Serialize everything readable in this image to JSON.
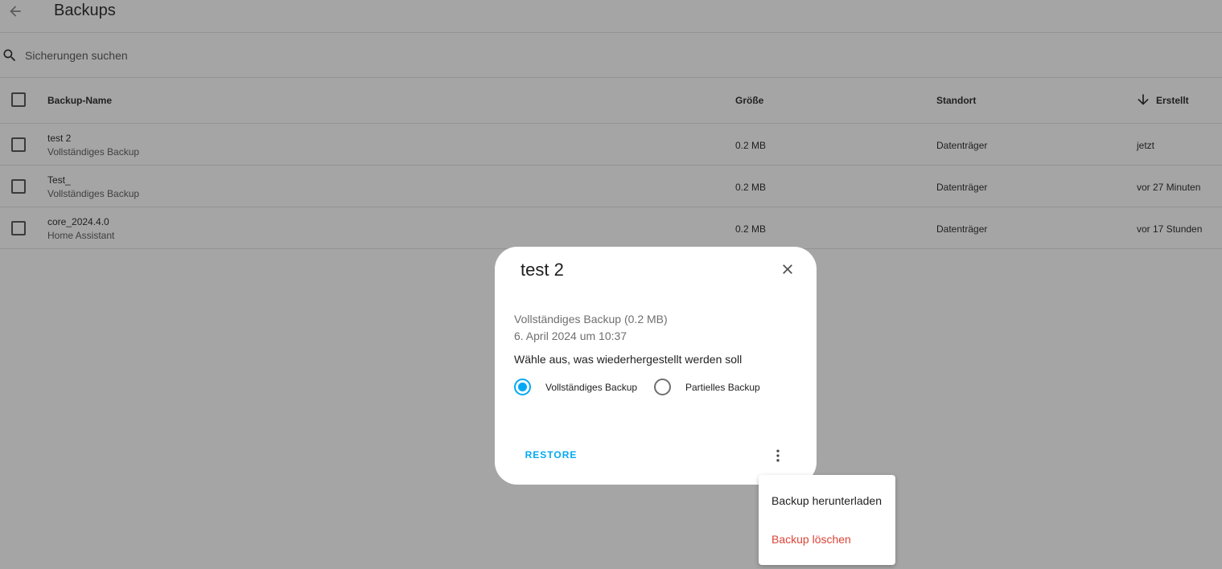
{
  "header": {
    "back_icon": "arrow-left-icon",
    "title": "Backups"
  },
  "search": {
    "icon": "search-icon",
    "placeholder": "Sicherungen suchen",
    "value": ""
  },
  "table": {
    "columns": {
      "name": "Backup-Name",
      "size": "Größe",
      "location": "Standort",
      "created": "Erstellt",
      "sort_icon": "arrow-down-icon"
    },
    "rows": [
      {
        "name": "test 2",
        "type": "Vollständiges Backup",
        "size": "0.2 MB",
        "location": "Datenträger",
        "created": "jetzt"
      },
      {
        "name": "Test_",
        "type": "Vollständiges Backup",
        "size": "0.2 MB",
        "location": "Datenträger",
        "created": "vor 27 Minuten"
      },
      {
        "name": "core_2024.4.0",
        "type": "Home Assistant",
        "size": "0.2 MB",
        "location": "Datenträger",
        "created": "vor 17 Stunden"
      }
    ]
  },
  "dialog": {
    "title": "test 2",
    "close_icon": "close-icon",
    "summary": "Vollständiges Backup (0.2 MB)",
    "date": "6. April 2024 um 10:37",
    "question": "Wähle aus, was wiederhergestellt werden soll",
    "options": [
      {
        "label": "Vollständiges Backup",
        "selected": true
      },
      {
        "label": "Partielles Backup",
        "selected": false
      }
    ],
    "restore_label": "RESTORE",
    "more_icon": "more-vertical-icon"
  },
  "menu": {
    "items": [
      {
        "label": "Backup herunterladen"
      },
      {
        "label": "Backup löschen"
      }
    ]
  },
  "colors": {
    "accent": "#03a9f4",
    "danger": "#db4437",
    "overlay_background": "#a5a5a5"
  }
}
